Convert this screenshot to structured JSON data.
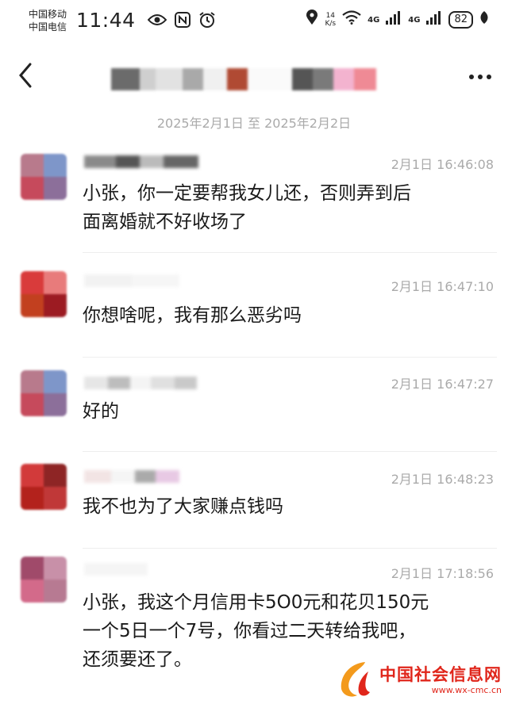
{
  "status_bar": {
    "carrier_1": "中国移动",
    "carrier_2": "中国电信",
    "time": "11:44",
    "speed_value": "14",
    "speed_unit": "K/s",
    "network_1": "4G",
    "network_2": "4G",
    "battery": "82",
    "icons": [
      "eye-icon",
      "nfc-icon",
      "alarm-icon",
      "location-icon",
      "wifi-icon",
      "signal-icon",
      "leaf-icon"
    ]
  },
  "header": {
    "back_glyph": "‹",
    "more_glyph": "•••"
  },
  "date_range": "2025年2月1日 至 2025年2月2日",
  "messages": [
    {
      "time": "2月1日  16:46:08",
      "text_lines": [
        "小张，你一定要帮我女儿还，否则弄到后",
        "面离婚就不好收场了"
      ]
    },
    {
      "time": "2月1日  16:47:10",
      "text_lines": [
        "你想啥呢，我有那么恶劣吗"
      ]
    },
    {
      "time": "2月1日  16:47:27",
      "text_lines": [
        "好的"
      ]
    },
    {
      "time": "2月1日  16:48:23",
      "text_lines": [
        "我不也为了大家赚点钱吗"
      ]
    },
    {
      "time": "2月1日  17:18:56",
      "text_lines": [
        "小张，我这个月信用卡5O0元和花贝150元",
        "一个5日一个7号，你看过二天转给我吧，",
        "还须要还了。"
      ]
    }
  ],
  "watermark": {
    "name": "中国社会信息网",
    "url": "www.wx-cmc.cn"
  },
  "colors": {
    "accent_red": "#e0261b",
    "muted_text": "#aaaaaa"
  }
}
